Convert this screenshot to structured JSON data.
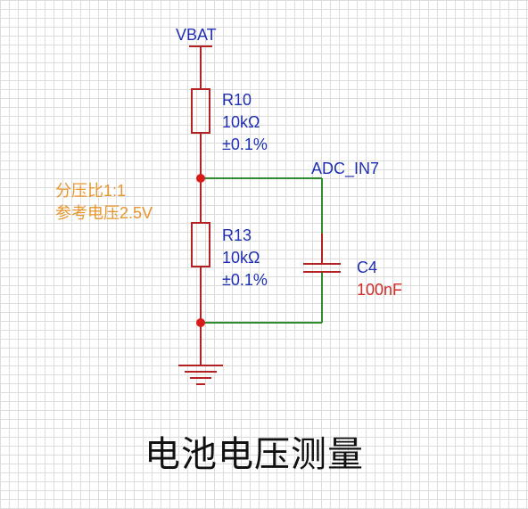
{
  "power": {
    "net": "VBAT"
  },
  "r10": {
    "ref": "R10",
    "value": "10kΩ",
    "tolerance": "±0.1%"
  },
  "r13": {
    "ref": "R13",
    "value": "10kΩ",
    "tolerance": "±0.1%"
  },
  "c4": {
    "ref": "C4",
    "value": "100nF"
  },
  "net_label": "ADC_IN7",
  "annotation": {
    "line1": "分压比1:1",
    "line2": "参考电压2.5V"
  },
  "title": "电池电压测量",
  "colors": {
    "component": "#b22222",
    "wire": "#2e8b2e",
    "junction": "#d81b1b",
    "label": "#1f2fb3",
    "annotation": "#e8952c",
    "capacitor_value": "#d42a2a"
  }
}
